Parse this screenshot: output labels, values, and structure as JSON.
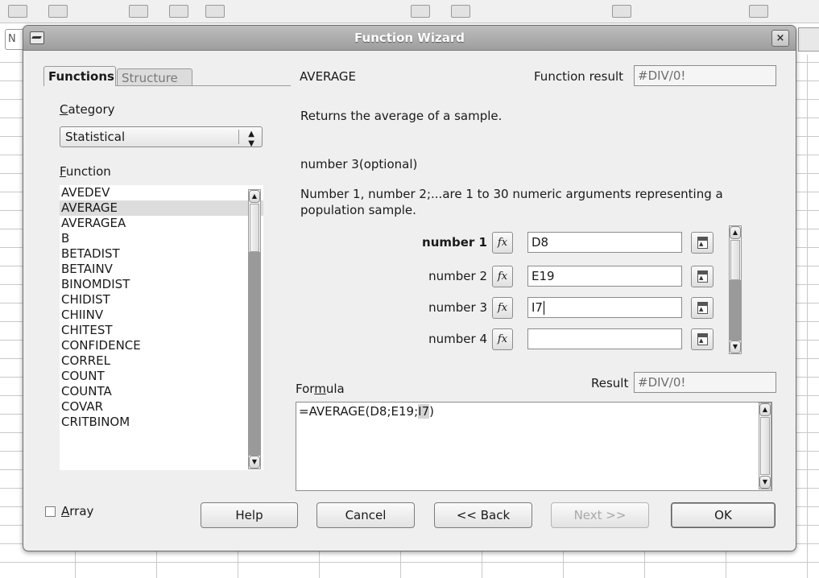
{
  "background": {
    "namebox": "N"
  },
  "dialog": {
    "title": "Function Wizard",
    "close_label": "×",
    "tabs": [
      {
        "label": "Functions",
        "active": true
      },
      {
        "label": "Structure",
        "active": false
      }
    ],
    "category_label": "Category",
    "category_value": "Statistical",
    "function_label": "Function",
    "functions": [
      "AVEDEV",
      "AVERAGE",
      "AVERAGEA",
      "B",
      "BETADIST",
      "BETAINV",
      "BINOMDIST",
      "CHIDIST",
      "CHIINV",
      "CHITEST",
      "CONFIDENCE",
      "CORREL",
      "COUNT",
      "COUNTA",
      "COVAR",
      "CRITBINOM"
    ],
    "selected_function": "AVERAGE",
    "function_name": "AVERAGE",
    "function_result_label": "Function result",
    "function_result_value": "#DIV/0!",
    "description": "Returns the average of a sample.",
    "arg_title": "number 3(optional)",
    "arg_desc_line1": "Number 1, number 2;...are 1 to 30 numeric arguments representing a",
    "arg_desc_line2": "population sample.",
    "args": [
      {
        "label": "number 1",
        "value": "D8",
        "bold": true
      },
      {
        "label": "number 2",
        "value": "E19",
        "bold": false
      },
      {
        "label": "number 3",
        "value": "I7",
        "bold": false
      },
      {
        "label": "number 4",
        "value": "",
        "bold": false
      }
    ],
    "fx_label": "fx",
    "formula_label": "Formula",
    "result_label": "Result",
    "result_value": "#DIV/0!",
    "formula_prefix": "=AVERAGE(D8;E19;",
    "formula_highlight": "I7",
    "formula_suffix": ")",
    "array_label": "Array",
    "array_checked": false,
    "buttons": {
      "help": "Help",
      "cancel": "Cancel",
      "back": "<< Back",
      "next": "Next >>",
      "ok": "OK"
    }
  }
}
